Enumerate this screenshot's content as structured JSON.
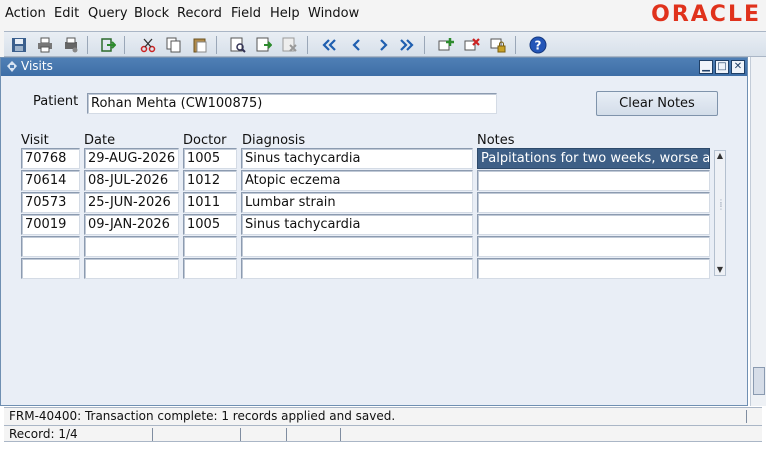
{
  "menu": {
    "items": [
      {
        "label": "Action"
      },
      {
        "label": "Edit"
      },
      {
        "label": "Query"
      },
      {
        "label": "Block"
      },
      {
        "label": "Record"
      },
      {
        "label": "Field"
      },
      {
        "label": "Help"
      },
      {
        "label": "Window"
      }
    ],
    "brand": "ORACLE"
  },
  "toolbar": {
    "icons": [
      "save-icon",
      "print-icon",
      "print-setup-icon",
      "exit-icon",
      "cut-icon",
      "copy-icon",
      "paste-icon",
      "enter-query-icon",
      "execute-query-icon",
      "cancel-query-icon",
      "first-record-icon",
      "previous-record-icon",
      "next-record-icon",
      "last-record-icon",
      "insert-record-icon",
      "delete-record-icon",
      "lock-record-icon",
      "help-icon"
    ]
  },
  "window": {
    "title": "Visits"
  },
  "form": {
    "patient_label": "Patient",
    "patient_value": "Rohan Mehta  (CW100875)",
    "clear_notes_label": "Clear Notes",
    "columns": {
      "visit": "Visit",
      "date": "Date",
      "doctor": "Doctor",
      "diagnosis": "Diagnosis",
      "notes": "Notes"
    },
    "rows": [
      {
        "visit": "70768",
        "date": "29-AUG-2026",
        "doctor": "1005",
        "diagnosis": "Sinus tachycardia",
        "notes": "Palpitations for two weeks, worse aft"
      },
      {
        "visit": "70614",
        "date": "08-JUL-2026",
        "doctor": "1012",
        "diagnosis": "Atopic eczema",
        "notes": ""
      },
      {
        "visit": "70573",
        "date": "25-JUN-2026",
        "doctor": "1011",
        "diagnosis": "Lumbar strain",
        "notes": ""
      },
      {
        "visit": "70019",
        "date": "09-JAN-2026",
        "doctor": "1005",
        "diagnosis": "Sinus tachycardia",
        "notes": ""
      },
      {
        "visit": "",
        "date": "",
        "doctor": "",
        "diagnosis": "",
        "notes": ""
      },
      {
        "visit": "",
        "date": "",
        "doctor": "",
        "diagnosis": "",
        "notes": ""
      }
    ]
  },
  "status": {
    "message": "FRM-40400: Transaction complete: 1 records applied and saved.",
    "record": "Record: 1/4"
  },
  "colors": {
    "title_bar": "#3e6ea6",
    "selected_field": "#3e5f86",
    "oracle_red": "#e0321c"
  }
}
